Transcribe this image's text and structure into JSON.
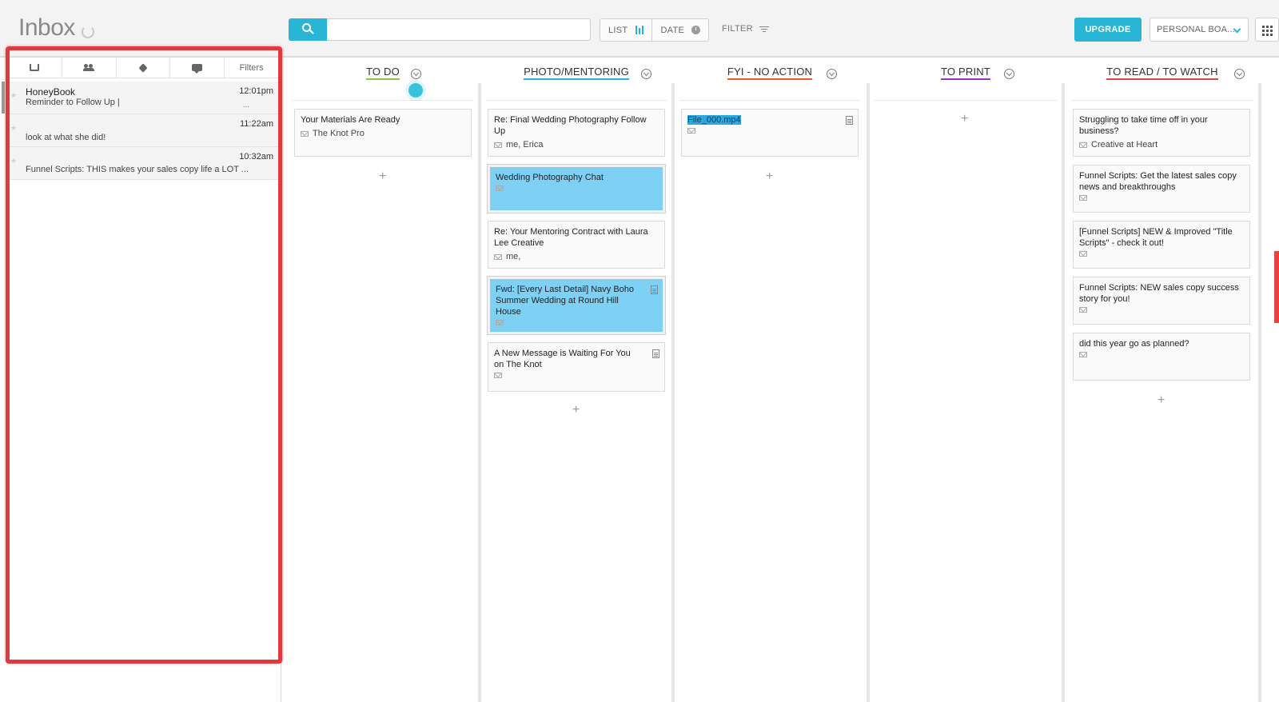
{
  "header": {
    "inbox_title": "Inbox",
    "search_placeholder": "",
    "view_list": "LIST",
    "view_date": "DATE",
    "filter": "FILTER",
    "upgrade": "UPGRADE",
    "board_name": "PERSONAL BOA..."
  },
  "left_panel": {
    "filters_label": "Filters",
    "emails": [
      {
        "sender": "HoneyBook",
        "subject": "Reminder to Follow Up |",
        "time": "12:01pm",
        "more": "..."
      },
      {
        "sender": "",
        "subject": "look at what she did!",
        "time": "11:22am",
        "more": ""
      },
      {
        "sender": "",
        "subject": "Funnel Scripts: THIS makes your sales copy life a LOT ...",
        "time": "10:32am",
        "more": ""
      }
    ]
  },
  "columns": [
    {
      "title": "TO DO",
      "color": "#8cc63f",
      "cards": [
        {
          "title": "Your Materials Are Ready",
          "from": "The Knot Pro"
        }
      ]
    },
    {
      "title": "PHOTO/MENTORING",
      "color": "#29b6d4",
      "cards": [
        {
          "title": "Re: Final Wedding Photography Follow Up",
          "from": "me, Erica"
        },
        {
          "title": "Wedding Photography Chat",
          "from": ""
        },
        {
          "title": "Re: Your Mentoring Contract with Laura Lee Creative",
          "from": "me,"
        },
        {
          "title": "Fwd: [Every Last Detail] Navy Boho Summer Wedding at Round Hill House",
          "from": ""
        },
        {
          "title": "A New Message is Waiting For You on The Knot",
          "from": ""
        }
      ]
    },
    {
      "title": "FYI - NO ACTION",
      "color": "#f15a24",
      "cards": [
        {
          "title": "File_000.mp4",
          "from": ""
        }
      ]
    },
    {
      "title": "TO PRINT",
      "color": "#9b30c8",
      "cards": []
    },
    {
      "title": "TO READ / TO WATCH",
      "color": "#e8414a",
      "cards": [
        {
          "title": "Struggling to take time off in your business?",
          "from": "Creative at Heart"
        },
        {
          "title": "Funnel Scripts: Get the latest sales copy news and breakthroughs",
          "from": ""
        },
        {
          "title": "[Funnel Scripts] NEW & Improved \"Title Scripts\" - check it out!",
          "from": ""
        },
        {
          "title": "Funnel Scripts: NEW sales copy success story for you!",
          "from": ""
        },
        {
          "title": "did this year go as planned?",
          "from": ""
        }
      ]
    }
  ],
  "add_symbol": "+"
}
